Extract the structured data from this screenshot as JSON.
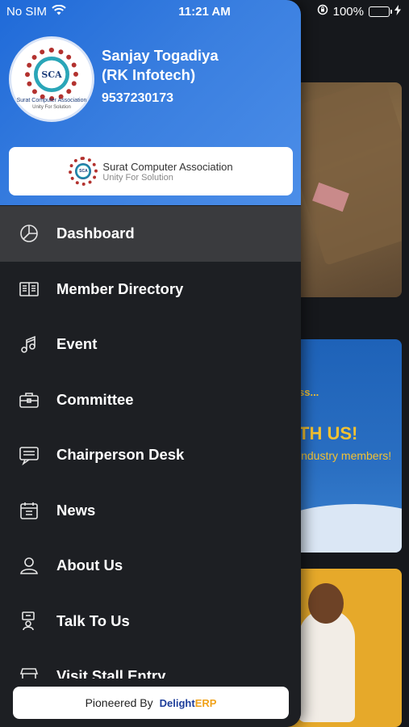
{
  "status_bar": {
    "carrier": "No SIM",
    "time": "11:21 AM",
    "battery": "100%"
  },
  "drawer": {
    "user": {
      "name_line1": "Sanjay Togadiya",
      "name_line2": "(RK Infotech)",
      "phone": "9537230173"
    },
    "avatar_logo": {
      "abbr": "SCA",
      "caption": "Surat Computer Association",
      "tagline": "Unity For Solution"
    },
    "org_card": {
      "abbr": "SCA",
      "name": "Surat Computer Association",
      "tagline": "Unity For Solution"
    },
    "menu": [
      {
        "label": "Dashboard",
        "icon": "pie-chart-icon",
        "active": true
      },
      {
        "label": "Member Directory",
        "icon": "book-icon",
        "active": false
      },
      {
        "label": "Event",
        "icon": "music-note-icon",
        "active": false
      },
      {
        "label": "Committee",
        "icon": "briefcase-icon",
        "active": false
      },
      {
        "label": "Chairperson Desk",
        "icon": "chat-icon",
        "active": false
      },
      {
        "label": "News",
        "icon": "calendar-icon",
        "active": false
      },
      {
        "label": "About Us",
        "icon": "user-icon",
        "active": false
      },
      {
        "label": "Talk To Us",
        "icon": "support-icon",
        "active": false
      },
      {
        "label": "Visit Stall Entry",
        "icon": "stall-icon",
        "active": false
      }
    ],
    "footer": {
      "pioneered_by": "Pioneered By",
      "brand_part1": "Delight",
      "brand_part2": "ERP"
    }
  },
  "background": {
    "card2_line1": "ss...",
    "card2_line2": "TH US!",
    "card2_line3": "industry members!"
  },
  "colors": {
    "header_gradient_start": "#1f6ad8",
    "header_gradient_end": "#4c8ee8",
    "drawer_bg": "#1d1f23",
    "active_item_bg": "#3a3b3e",
    "battery_green": "#4cd964"
  }
}
